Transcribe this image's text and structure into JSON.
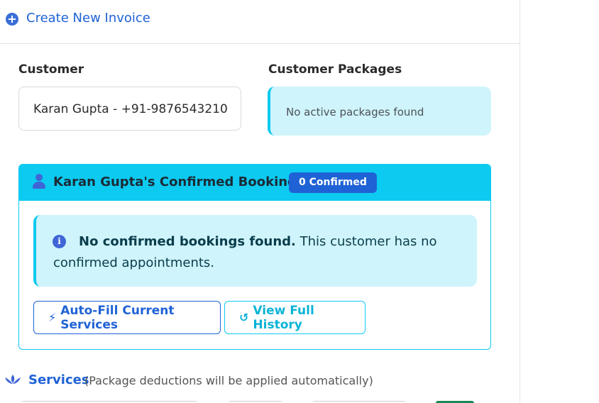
{
  "header": {
    "title": "Create New Invoice",
    "icon": "plus-circle-icon"
  },
  "customer": {
    "label": "Customer",
    "selected_value": "Karan Gupta - +91-9876543210"
  },
  "packages": {
    "label": "Customer Packages",
    "message": "No active packages found"
  },
  "bookings": {
    "title": "Karan Gupta's Confirmed Bookings",
    "badge": "0 Confirmed",
    "alert_bold": "No confirmed bookings found.",
    "alert_rest": " This customer has no confirmed appointments.",
    "autofill_button": "Auto-Fill Current Services",
    "history_button": "View Full History"
  },
  "services": {
    "title": "Services",
    "note": "(Package deductions will be applied automatically)"
  },
  "colors": {
    "primary": "#1f62d6",
    "info": "#0dcaf0",
    "info_bg": "#cff4fc",
    "success": "#198754"
  }
}
